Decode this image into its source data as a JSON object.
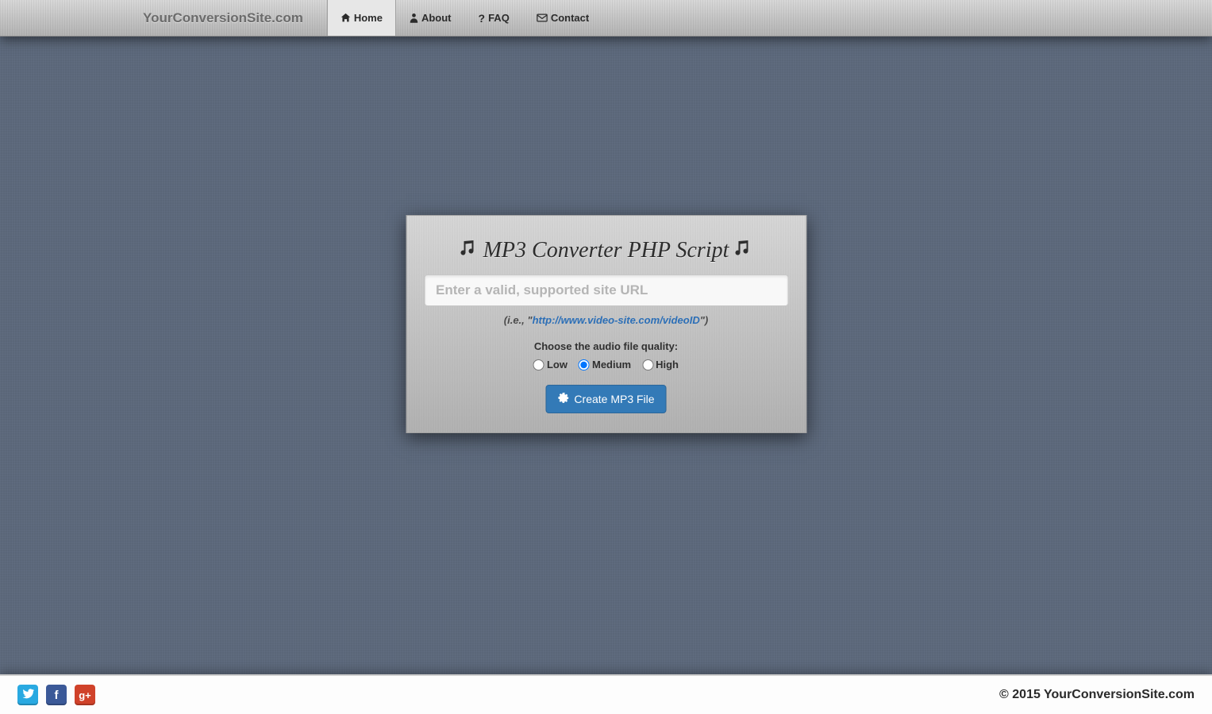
{
  "brand": "YourConversionSite.com",
  "nav": {
    "home": "Home",
    "about": "About",
    "faq": "FAQ",
    "contact": "Contact"
  },
  "card": {
    "title": "MP3 Converter PHP Script",
    "url_placeholder": "Enter a valid, supported site URL",
    "hint_prefix": "(i.e., \"",
    "hint_link": "http://www.video-site.com/videoID",
    "hint_suffix": "\")",
    "quality_label": "Choose the audio file quality:",
    "quality": {
      "low": "Low",
      "medium": "Medium",
      "high": "High",
      "selected": "medium"
    },
    "button": "Create MP3 File"
  },
  "footer": {
    "copyright": "© 2015 YourConversionSite.com"
  }
}
